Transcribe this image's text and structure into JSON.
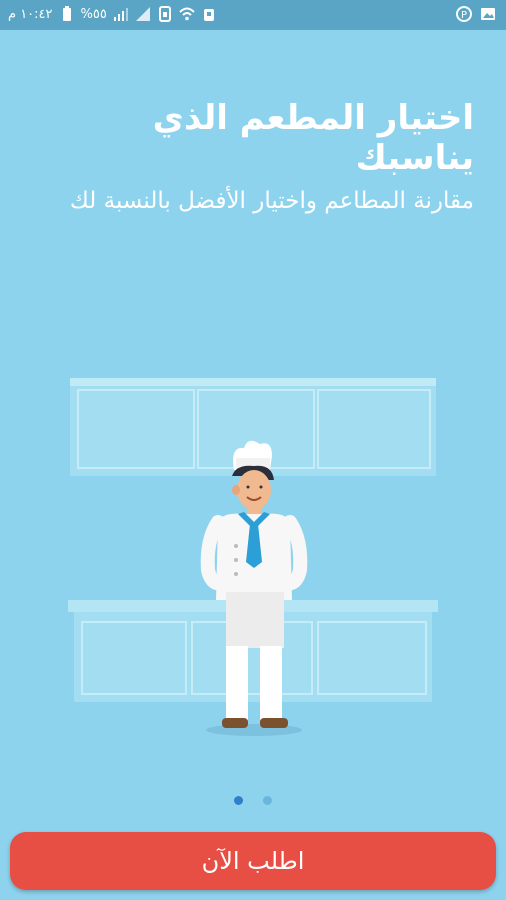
{
  "status_bar": {
    "time": "١٠:٤٢ م",
    "battery": "%٥٥",
    "icons": [
      "battery-icon",
      "signal-icon",
      "signal-icon",
      "sim-icon",
      "wifi-icon",
      "android-icon",
      "pinterest-icon",
      "image-icon"
    ]
  },
  "onboarding": {
    "title": "اختيار المطعم الذي يناسبك",
    "subtitle": "مقارنة المطاعم واختيار الأفضل بالنسبة لك",
    "illustration": "chef-in-kitchen-illustration",
    "page_indicator": {
      "current": 1,
      "total": 2
    },
    "cta_label": "اطلب الآن"
  },
  "colors": {
    "background": "#8ed3ee",
    "status_bar": "#5aa5c6",
    "cta": "#e84f44",
    "dot_active": "#2f7fcc",
    "dot_inactive": "#6ab6dd"
  }
}
